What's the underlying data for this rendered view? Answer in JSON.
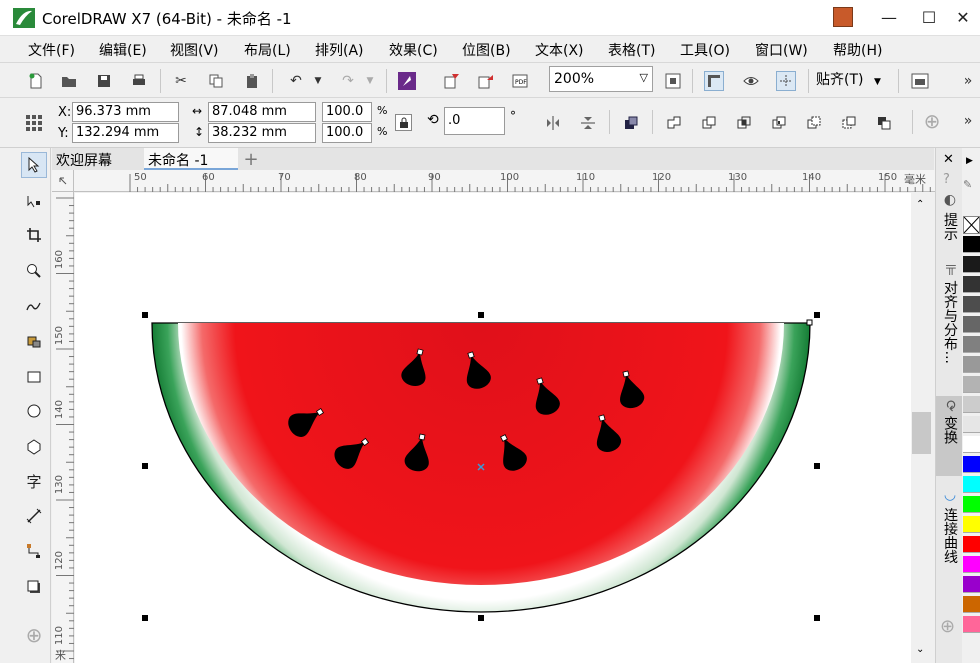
{
  "window": {
    "title": "CorelDRAW X7 (64-Bit) - 未命名 -1",
    "minimize": "—",
    "maximize": "☐",
    "close": "✕"
  },
  "menu": [
    "文件(F)",
    "编辑(E)",
    "视图(V)",
    "布局(L)",
    "排列(A)",
    "效果(C)",
    "位图(B)",
    "文本(X)",
    "表格(T)",
    "工具(O)",
    "窗口(W)",
    "帮助(H)"
  ],
  "toolbar": {
    "zoom_value": "200%",
    "snap_label": "贴齐(T)"
  },
  "properties": {
    "x_label": "X:",
    "x_value": "96.373 mm",
    "y_label": "Y:",
    "y_value": "132.294 mm",
    "width_value": "87.048 mm",
    "height_value": "38.232 mm",
    "scale_w": "100.0",
    "scale_h": "100.0",
    "percent": "%",
    "rotation": ".0",
    "degree": "°"
  },
  "tabs": {
    "welcome": "欢迎屏幕",
    "document": "未命名 -1"
  },
  "ruler": {
    "h_ticks": [
      "50",
      "60",
      "70",
      "80",
      "90",
      "100",
      "110",
      "120",
      "130",
      "140",
      "150"
    ],
    "v_ticks": [
      "160",
      "150",
      "140",
      "130",
      "120",
      "110"
    ],
    "unit": "毫米",
    "v_unit": "米"
  },
  "dockers": [
    "提示",
    "对齐与分布...",
    "变换",
    "连接曲线"
  ],
  "palette": [
    "#000000",
    "#1a1a1a",
    "#333333",
    "#4d4d4d",
    "#666666",
    "#808080",
    "#999999",
    "#b3b3b3",
    "#cccccc",
    "#e6e6e6",
    "#ffffff",
    "#0000ff",
    "#00ffff",
    "#00ff00",
    "#ffff00",
    "#ff0000",
    "#ff00ff",
    "#9900cc",
    "#cc6600",
    "#ff6699"
  ],
  "colors": {
    "flesh": "#e8141a",
    "rind": "#1a8a3a",
    "seed": "#000000"
  }
}
